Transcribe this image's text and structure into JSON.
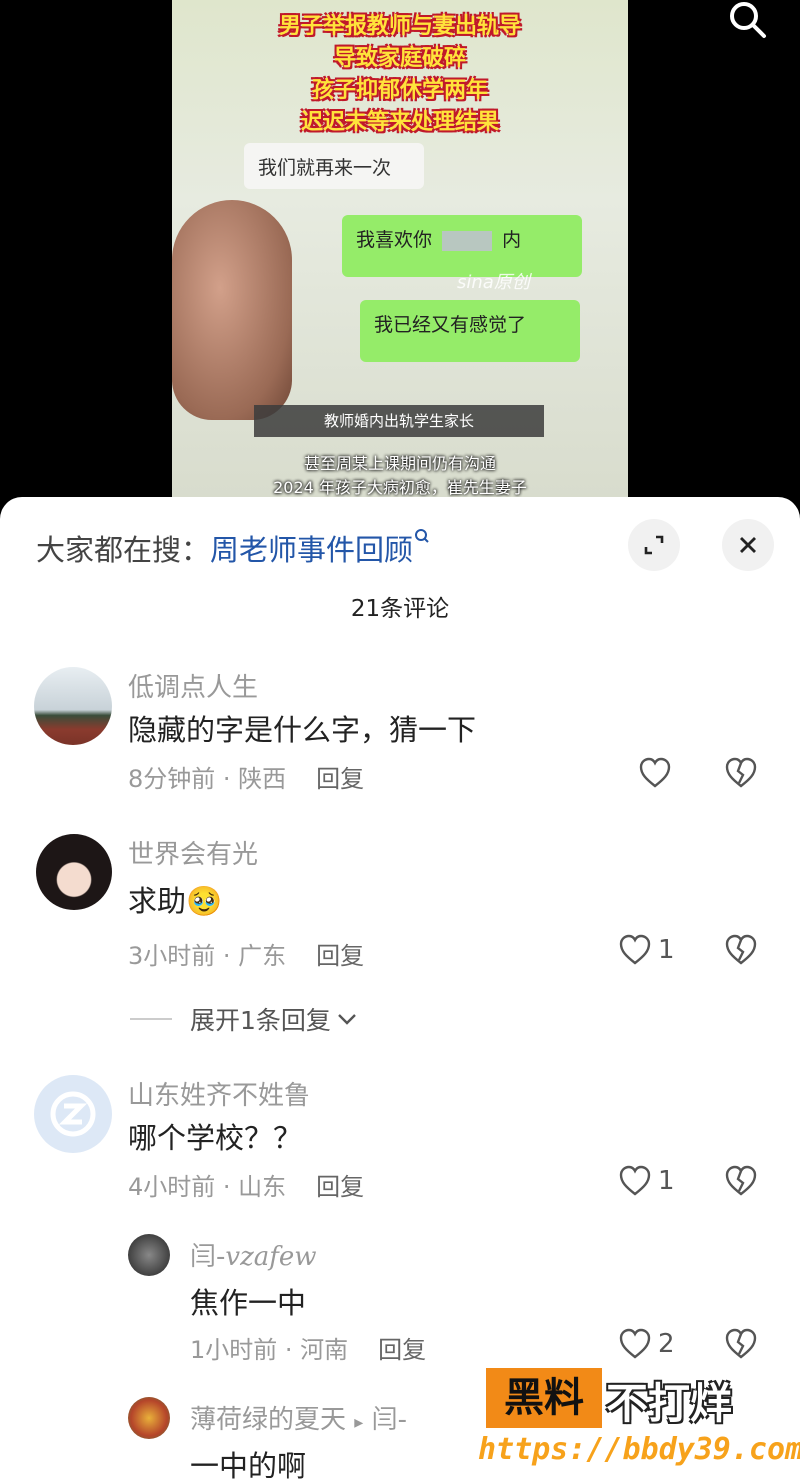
{
  "video": {
    "caption_lines": [
      "男子举报教师与妻出轨导",
      "导致家庭破碎",
      "孩子抑郁休学两年",
      "迟迟未等来处理结果"
    ],
    "chat_grey": "我们就再来一次",
    "chat_green_1": "我喜欢你",
    "chat_green_1_end": "内",
    "chat_green_2": "我已经又有感觉了",
    "watermark": "sina原创",
    "subtitle_box": "教师婚内出轨学生家长",
    "subtitle_lines": [
      "甚至周某上课期间仍有沟通",
      "2024 年孩子大病初愈，崔先生妻子"
    ]
  },
  "sheet": {
    "hot_label": "大家都在搜：",
    "hot_link": "周老师事件回顾",
    "count": "21条评论"
  },
  "comments": [
    {
      "name": "低调点人生",
      "text": "隐藏的字是什么字，猜一下",
      "time": "8分钟前",
      "location": "陕西",
      "reply": "回复",
      "likes": ""
    },
    {
      "name": "世界会有光",
      "text": "求助🥹",
      "time": "3小时前",
      "location": "广东",
      "reply": "回复",
      "likes": "1",
      "expand": "展开1条回复"
    },
    {
      "name": "山东姓齐不姓鲁",
      "text": "哪个学校？？",
      "time": "4小时前",
      "location": "山东",
      "reply": "回复",
      "likes": "1"
    }
  ],
  "replies": [
    {
      "name": "闫-",
      "name_script": "vzafew",
      "text": "焦作一中",
      "time": "1小时前",
      "location": "河南",
      "reply": "回复",
      "likes": "2"
    },
    {
      "name": "薄荷绿的夏天",
      "arrow": "▸",
      "to": "闫-",
      "text": "一中的啊"
    }
  ],
  "ad": {
    "badge": "黑料",
    "title": "不打烊",
    "url": "https://bbdy39.com"
  },
  "colors": {
    "link": "#2356a8",
    "ad_orange": "#f28a17",
    "chat_green": "#95ec69",
    "caption_yellow": "#ffe33b"
  },
  "icons": [
    "search-icon",
    "expand-icon",
    "close-icon",
    "heart-icon",
    "broken-heart-icon",
    "chevron-down-icon"
  ]
}
